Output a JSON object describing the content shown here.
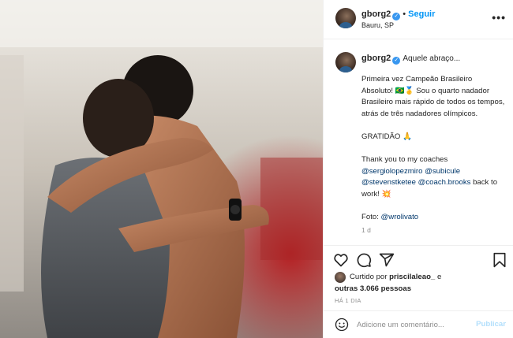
{
  "post": {
    "username": "gborg2",
    "location": "Bauru, SP",
    "follow_label": "Seguir",
    "dot": "•",
    "more_label": "•••"
  },
  "caption": {
    "username": "gborg2",
    "intro": "Aquele abraço...",
    "paragraph1": "Primeira vez Campeão Brasileiro Absoluto! 🇧🇷🥇 Sou o quarto nadador Brasileiro mais rápido de todos os tempos, atrás de três nadadores olímpicos.",
    "paragraph2": "GRATIDÃO 🙏",
    "paragraph3_prefix": "Thank you to my coaches",
    "mentions": [
      "@sergiolopezmiro",
      "@subicule",
      "@stevenstketee",
      "@coach.brooks"
    ],
    "paragraph3_suffix": "back to work! 💥",
    "photo_prefix": "Foto:",
    "photo_mention": "@wrolivato",
    "time": "1 d"
  },
  "likes": {
    "liked_by_prefix": "Curtido por",
    "liked_by_user": "priscilaleao_",
    "and": "e",
    "others": "outras 3.066 pessoas"
  },
  "timestamp": "HÁ 1 DIA",
  "comment": {
    "placeholder": "Adicione um comentário...",
    "publish_label": "Publicar"
  },
  "icons": {
    "like": "heart-icon",
    "comment": "comment-icon",
    "share": "share-icon",
    "save": "bookmark-icon",
    "emoji": "emoji-icon",
    "verified": "verified-badge-icon",
    "more": "more-options-icon"
  },
  "colors": {
    "link": "#0095f6",
    "mention": "#00376b",
    "muted": "#8e8e8e",
    "verified": "#3897f0",
    "publish_disabled": "#b2dffc"
  }
}
